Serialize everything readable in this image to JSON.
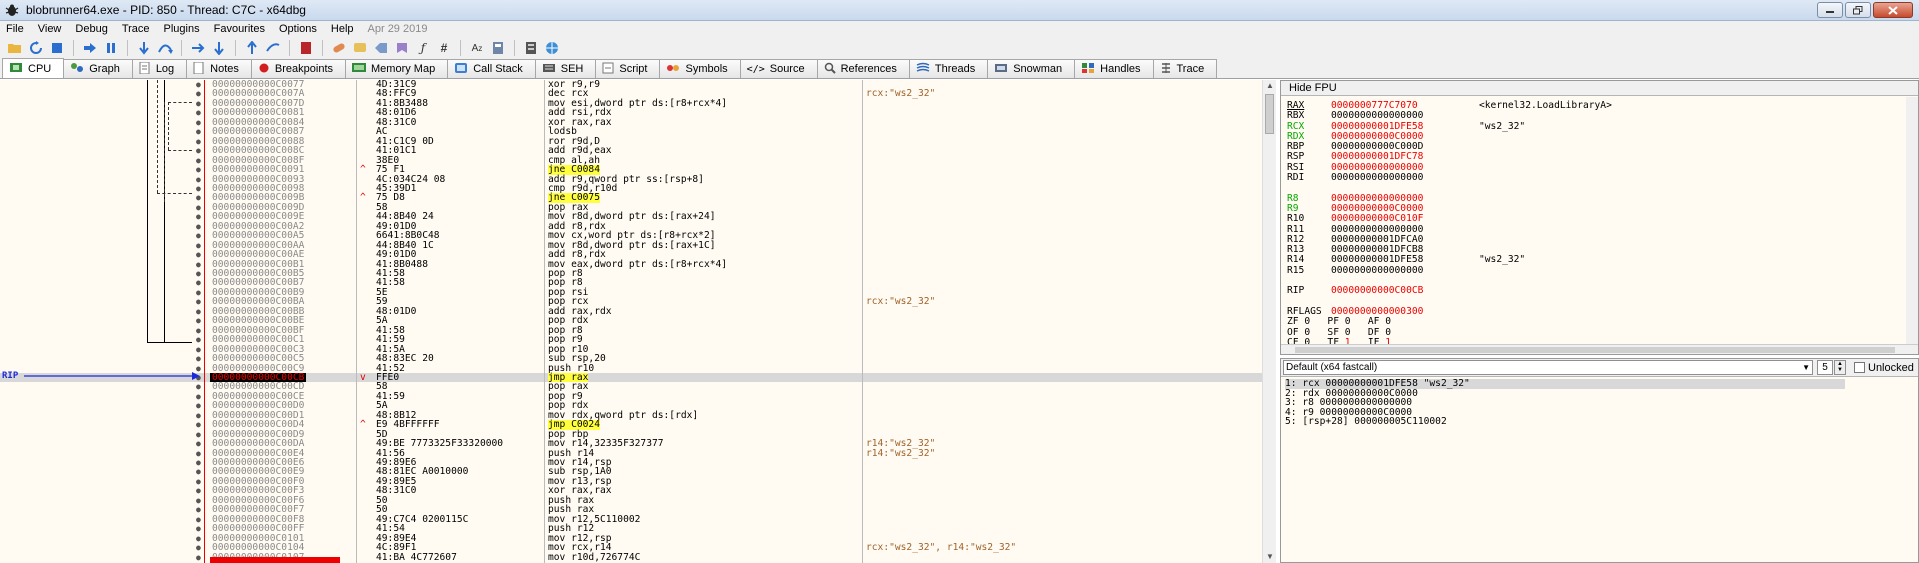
{
  "window": {
    "title": "blobrunner64.exe - PID: 850 - Thread: C7C - x64dbg",
    "controls": [
      "minimize",
      "restore",
      "close"
    ]
  },
  "menu": {
    "items": [
      "File",
      "View",
      "Debug",
      "Trace",
      "Plugins",
      "Favourites",
      "Options",
      "Help"
    ],
    "date": "Apr 29 2019"
  },
  "tabs": [
    {
      "label": "CPU",
      "icon": "cpu-icon"
    },
    {
      "label": "Graph",
      "icon": "graph-icon"
    },
    {
      "label": "Log",
      "icon": "log-icon"
    },
    {
      "label": "Notes",
      "icon": "notes-icon"
    },
    {
      "label": "Breakpoints",
      "icon": "breakpoint-icon"
    },
    {
      "label": "Memory Map",
      "icon": "memory-map-icon"
    },
    {
      "label": "Call Stack",
      "icon": "call-stack-icon"
    },
    {
      "label": "SEH",
      "icon": "seh-icon"
    },
    {
      "label": "Script",
      "icon": "script-icon"
    },
    {
      "label": "Symbols",
      "icon": "symbols-icon"
    },
    {
      "label": "Source",
      "icon": "source-icon"
    },
    {
      "label": "References",
      "icon": "references-icon"
    },
    {
      "label": "Threads",
      "icon": "threads-icon"
    },
    {
      "label": "Snowman",
      "icon": "snowman-icon"
    },
    {
      "label": "Handles",
      "icon": "handles-icon"
    },
    {
      "label": "Trace",
      "icon": "trace-icon"
    }
  ],
  "disasm": {
    "rip_label": "RIP",
    "rows": [
      {
        "addr": "00000000000C0077",
        "arrow": "",
        "bytes": "4D:31C9",
        "instr": "xor r9,r9",
        "cmt": ""
      },
      {
        "addr": "00000000000C007A",
        "arrow": "",
        "bytes": "48:FFC9",
        "instr": "dec rcx",
        "cmt": "rcx:\"ws2_32\""
      },
      {
        "addr": "00000000000C007D",
        "arrow": "",
        "bytes": "41:8B3488",
        "instr": "mov esi,dword ptr ds:[r8+rcx*4]",
        "cmt": ""
      },
      {
        "addr": "00000000000C0081",
        "arrow": "",
        "bytes": "48:01D6",
        "instr": "add rsi,rdx",
        "cmt": ""
      },
      {
        "addr": "00000000000C0084",
        "arrow": "",
        "bytes": "48:31C0",
        "instr": "xor rax,rax",
        "cmt": ""
      },
      {
        "addr": "00000000000C0087",
        "arrow": "",
        "bytes": "AC",
        "instr": "lodsb",
        "cmt": ""
      },
      {
        "addr": "00000000000C0088",
        "arrow": "",
        "bytes": "41:C1C9 0D",
        "instr": "ror r9d,D",
        "cmt": ""
      },
      {
        "addr": "00000000000C008C",
        "arrow": "",
        "bytes": "41:01C1",
        "instr": "add r9d,eax",
        "cmt": ""
      },
      {
        "addr": "00000000000C008F",
        "arrow": "",
        "bytes": "38E0",
        "instr": "cmp al,ah",
        "cmt": ""
      },
      {
        "addr": "00000000000C0091",
        "arrow": "^",
        "bytes": "75 F1",
        "instr": "jne C0084",
        "cmt": "",
        "hl": "jne C0084"
      },
      {
        "addr": "00000000000C0093",
        "arrow": "",
        "bytes": "4C:034C24 08",
        "instr": "add r9,qword ptr ss:[rsp+8]",
        "cmt": ""
      },
      {
        "addr": "00000000000C0098",
        "arrow": "",
        "bytes": "45:39D1",
        "instr": "cmp r9d,r10d",
        "cmt": ""
      },
      {
        "addr": "00000000000C009B",
        "arrow": "^",
        "bytes": "75 D8",
        "instr": "jne C0075",
        "cmt": "",
        "hl": "jne C0075"
      },
      {
        "addr": "00000000000C009D",
        "arrow": "",
        "bytes": "58",
        "instr": "pop rax",
        "cmt": ""
      },
      {
        "addr": "00000000000C009E",
        "arrow": "",
        "bytes": "44:8B40 24",
        "instr": "mov r8d,dword ptr ds:[rax+24]",
        "cmt": ""
      },
      {
        "addr": "00000000000C00A2",
        "arrow": "",
        "bytes": "49:01D0",
        "instr": "add r8,rdx",
        "cmt": ""
      },
      {
        "addr": "00000000000C00A5",
        "arrow": "",
        "bytes": "6641:8B0C48",
        "instr": "mov cx,word ptr ds:[r8+rcx*2]",
        "cmt": ""
      },
      {
        "addr": "00000000000C00AA",
        "arrow": "",
        "bytes": "44:8B40 1C",
        "instr": "mov r8d,dword ptr ds:[rax+1C]",
        "cmt": ""
      },
      {
        "addr": "00000000000C00AE",
        "arrow": "",
        "bytes": "49:01D0",
        "instr": "add r8,rdx",
        "cmt": ""
      },
      {
        "addr": "00000000000C00B1",
        "arrow": "",
        "bytes": "41:8B0488",
        "instr": "mov eax,dword ptr ds:[r8+rcx*4]",
        "cmt": ""
      },
      {
        "addr": "00000000000C00B5",
        "arrow": "",
        "bytes": "41:58",
        "instr": "pop r8",
        "cmt": ""
      },
      {
        "addr": "00000000000C00B7",
        "arrow": "",
        "bytes": "41:58",
        "instr": "pop r8",
        "cmt": ""
      },
      {
        "addr": "00000000000C00B9",
        "arrow": "",
        "bytes": "5E",
        "instr": "pop rsi",
        "cmt": ""
      },
      {
        "addr": "00000000000C00BA",
        "arrow": "",
        "bytes": "59",
        "instr": "pop rcx",
        "cmt": "rcx:\"ws2_32\""
      },
      {
        "addr": "00000000000C00BB",
        "arrow": "",
        "bytes": "48:01D0",
        "instr": "add rax,rdx",
        "cmt": ""
      },
      {
        "addr": "00000000000C00BE",
        "arrow": "",
        "bytes": "5A",
        "instr": "pop rdx",
        "cmt": ""
      },
      {
        "addr": "00000000000C00BF",
        "arrow": "",
        "bytes": "41:58",
        "instr": "pop r8",
        "cmt": ""
      },
      {
        "addr": "00000000000C00C1",
        "arrow": "",
        "bytes": "41:59",
        "instr": "pop r9",
        "cmt": ""
      },
      {
        "addr": "00000000000C00C3",
        "arrow": "",
        "bytes": "41:5A",
        "instr": "pop r10",
        "cmt": ""
      },
      {
        "addr": "00000000000C00C5",
        "arrow": "",
        "bytes": "48:83EC 20",
        "instr": "sub rsp,20",
        "cmt": ""
      },
      {
        "addr": "00000000000C00C9",
        "arrow": "",
        "bytes": "41:52",
        "instr": "push r10",
        "cmt": ""
      },
      {
        "addr": "00000000000C00CB",
        "arrow": "v",
        "bytes": "FFE0",
        "instr": "jmp rax",
        "cmt": "",
        "hl": "jmp rax",
        "sel": true
      },
      {
        "addr": "00000000000C00CD",
        "arrow": "",
        "bytes": "58",
        "instr": "pop rax",
        "cmt": ""
      },
      {
        "addr": "00000000000C00CE",
        "arrow": "",
        "bytes": "41:59",
        "instr": "pop r9",
        "cmt": ""
      },
      {
        "addr": "00000000000C00D0",
        "arrow": "",
        "bytes": "5A",
        "instr": "pop rdx",
        "cmt": ""
      },
      {
        "addr": "00000000000C00D1",
        "arrow": "",
        "bytes": "48:8B12",
        "instr": "mov rdx,qword ptr ds:[rdx]",
        "cmt": ""
      },
      {
        "addr": "00000000000C00D4",
        "arrow": "^",
        "bytes": "E9 4BFFFFFF",
        "instr": "jmp C0024",
        "cmt": "",
        "hl": "jmp C0024"
      },
      {
        "addr": "00000000000C00D9",
        "arrow": "",
        "bytes": "5D",
        "instr": "pop rbp",
        "cmt": ""
      },
      {
        "addr": "00000000000C00DA",
        "arrow": "",
        "bytes": "49:BE 7773325F33320000",
        "instr": "mov r14,32335F327377",
        "cmt": "r14:\"ws2_32\""
      },
      {
        "addr": "00000000000C00E4",
        "arrow": "",
        "bytes": "41:56",
        "instr": "push r14",
        "cmt": "r14:\"ws2_32\""
      },
      {
        "addr": "00000000000C00E6",
        "arrow": "",
        "bytes": "49:89E6",
        "instr": "mov r14,rsp",
        "cmt": ""
      },
      {
        "addr": "00000000000C00E9",
        "arrow": "",
        "bytes": "48:81EC A0010000",
        "instr": "sub rsp,1A0",
        "cmt": ""
      },
      {
        "addr": "00000000000C00F0",
        "arrow": "",
        "bytes": "49:89E5",
        "instr": "mov r13,rsp",
        "cmt": ""
      },
      {
        "addr": "00000000000C00F3",
        "arrow": "",
        "bytes": "48:31C0",
        "instr": "xor rax,rax",
        "cmt": ""
      },
      {
        "addr": "00000000000C00F6",
        "arrow": "",
        "bytes": "50",
        "instr": "push rax",
        "cmt": ""
      },
      {
        "addr": "00000000000C00F7",
        "arrow": "",
        "bytes": "50",
        "instr": "push rax",
        "cmt": ""
      },
      {
        "addr": "00000000000C00F8",
        "arrow": "",
        "bytes": "49:C7C4 0200115C",
        "instr": "mov r12,5C110002",
        "cmt": ""
      },
      {
        "addr": "00000000000C00FF",
        "arrow": "",
        "bytes": "41:54",
        "instr": "push r12",
        "cmt": ""
      },
      {
        "addr": "00000000000C0101",
        "arrow": "",
        "bytes": "49:89E4",
        "instr": "mov r12,rsp",
        "cmt": ""
      },
      {
        "addr": "00000000000C0104",
        "arrow": "",
        "bytes": "4C:89F1",
        "instr": "mov rcx,r14",
        "cmt": "rcx:\"ws2_32\", r14:\"ws2_32\""
      },
      {
        "addr": "00000000000C0107",
        "arrow": "",
        "bytes": "41:BA 4C772607",
        "instr": "mov r10d,726774C",
        "cmt": ""
      }
    ]
  },
  "registers": {
    "hide_fpu_label": "Hide FPU",
    "rows": [
      {
        "name": "RAX",
        "value": "0000000777C7070",
        "note": "<kernel32.LoadLibraryA>",
        "changed": true,
        "nameColor": "normal"
      },
      {
        "name": "RBX",
        "value": "0000000000000000",
        "note": "",
        "changed": false,
        "nameColor": "normal"
      },
      {
        "name": "RCX",
        "value": "00000000001DFE58",
        "note": "\"ws2_32\"",
        "changed": true,
        "nameColor": "green"
      },
      {
        "name": "RDX",
        "value": "00000000000C0000",
        "note": "",
        "changed": true,
        "nameColor": "green"
      },
      {
        "name": "RBP",
        "value": "00000000000C000D",
        "note": "",
        "changed": false,
        "nameColor": "normal"
      },
      {
        "name": "RSP",
        "value": "00000000001DFC78",
        "note": "",
        "changed": true,
        "nameColor": "normal"
      },
      {
        "name": "RSI",
        "value": "0000000000000000",
        "note": "",
        "changed": true,
        "nameColor": "normal"
      },
      {
        "name": "RDI",
        "value": "0000000000000000",
        "note": "",
        "changed": false,
        "nameColor": "normal"
      },
      {
        "name": "",
        "value": "",
        "note": "",
        "changed": false,
        "nameColor": "normal"
      },
      {
        "name": "R8",
        "value": "0000000000000000",
        "note": "",
        "changed": true,
        "nameColor": "green"
      },
      {
        "name": "R9",
        "value": "00000000000C0000",
        "note": "",
        "changed": true,
        "nameColor": "green"
      },
      {
        "name": "R10",
        "value": "00000000000C010F",
        "note": "",
        "changed": true,
        "nameColor": "normal"
      },
      {
        "name": "R11",
        "value": "0000000000000000",
        "note": "",
        "changed": false,
        "nameColor": "normal"
      },
      {
        "name": "R12",
        "value": "00000000001DFCA0",
        "note": "",
        "changed": false,
        "nameColor": "normal"
      },
      {
        "name": "R13",
        "value": "00000000001DFCB8",
        "note": "",
        "changed": false,
        "nameColor": "normal"
      },
      {
        "name": "R14",
        "value": "00000000001DFE58",
        "note": "\"ws2_32\"",
        "changed": false,
        "nameColor": "normal"
      },
      {
        "name": "R15",
        "value": "0000000000000000",
        "note": "",
        "changed": false,
        "nameColor": "normal"
      },
      {
        "name": "",
        "value": "",
        "note": "",
        "changed": false,
        "nameColor": "normal"
      },
      {
        "name": "RIP",
        "value": "00000000000C00CB",
        "note": "",
        "changed": true,
        "nameColor": "normal"
      },
      {
        "name": "",
        "value": "",
        "note": "",
        "changed": false,
        "nameColor": "normal"
      },
      {
        "name": "RFLAGS",
        "value": "0000000000000300",
        "note": "",
        "changed": true,
        "nameColor": "normal"
      }
    ],
    "flags": [
      "ZF 0   PF 0   AF 0",
      "OF 0   SF 0   DF 0",
      "CF 0   TF 1   IF 1"
    ]
  },
  "callstack": {
    "convention": "Default (x64 fastcall)",
    "count": "5",
    "unlocked_label": "Unlocked",
    "args": [
      "1: rcx 00000000001DFE58 \"ws2_32\"",
      "2: rdx 00000000000C0000",
      "3: r8 0000000000000000",
      "4: r9 00000000000C0000",
      "5: [rsp+28] 000000005C110002"
    ]
  },
  "colors": {
    "changed": "#e00000",
    "highlight": "#ffff40",
    "rip": "#1c2bd9",
    "comment": "#a0622a"
  }
}
